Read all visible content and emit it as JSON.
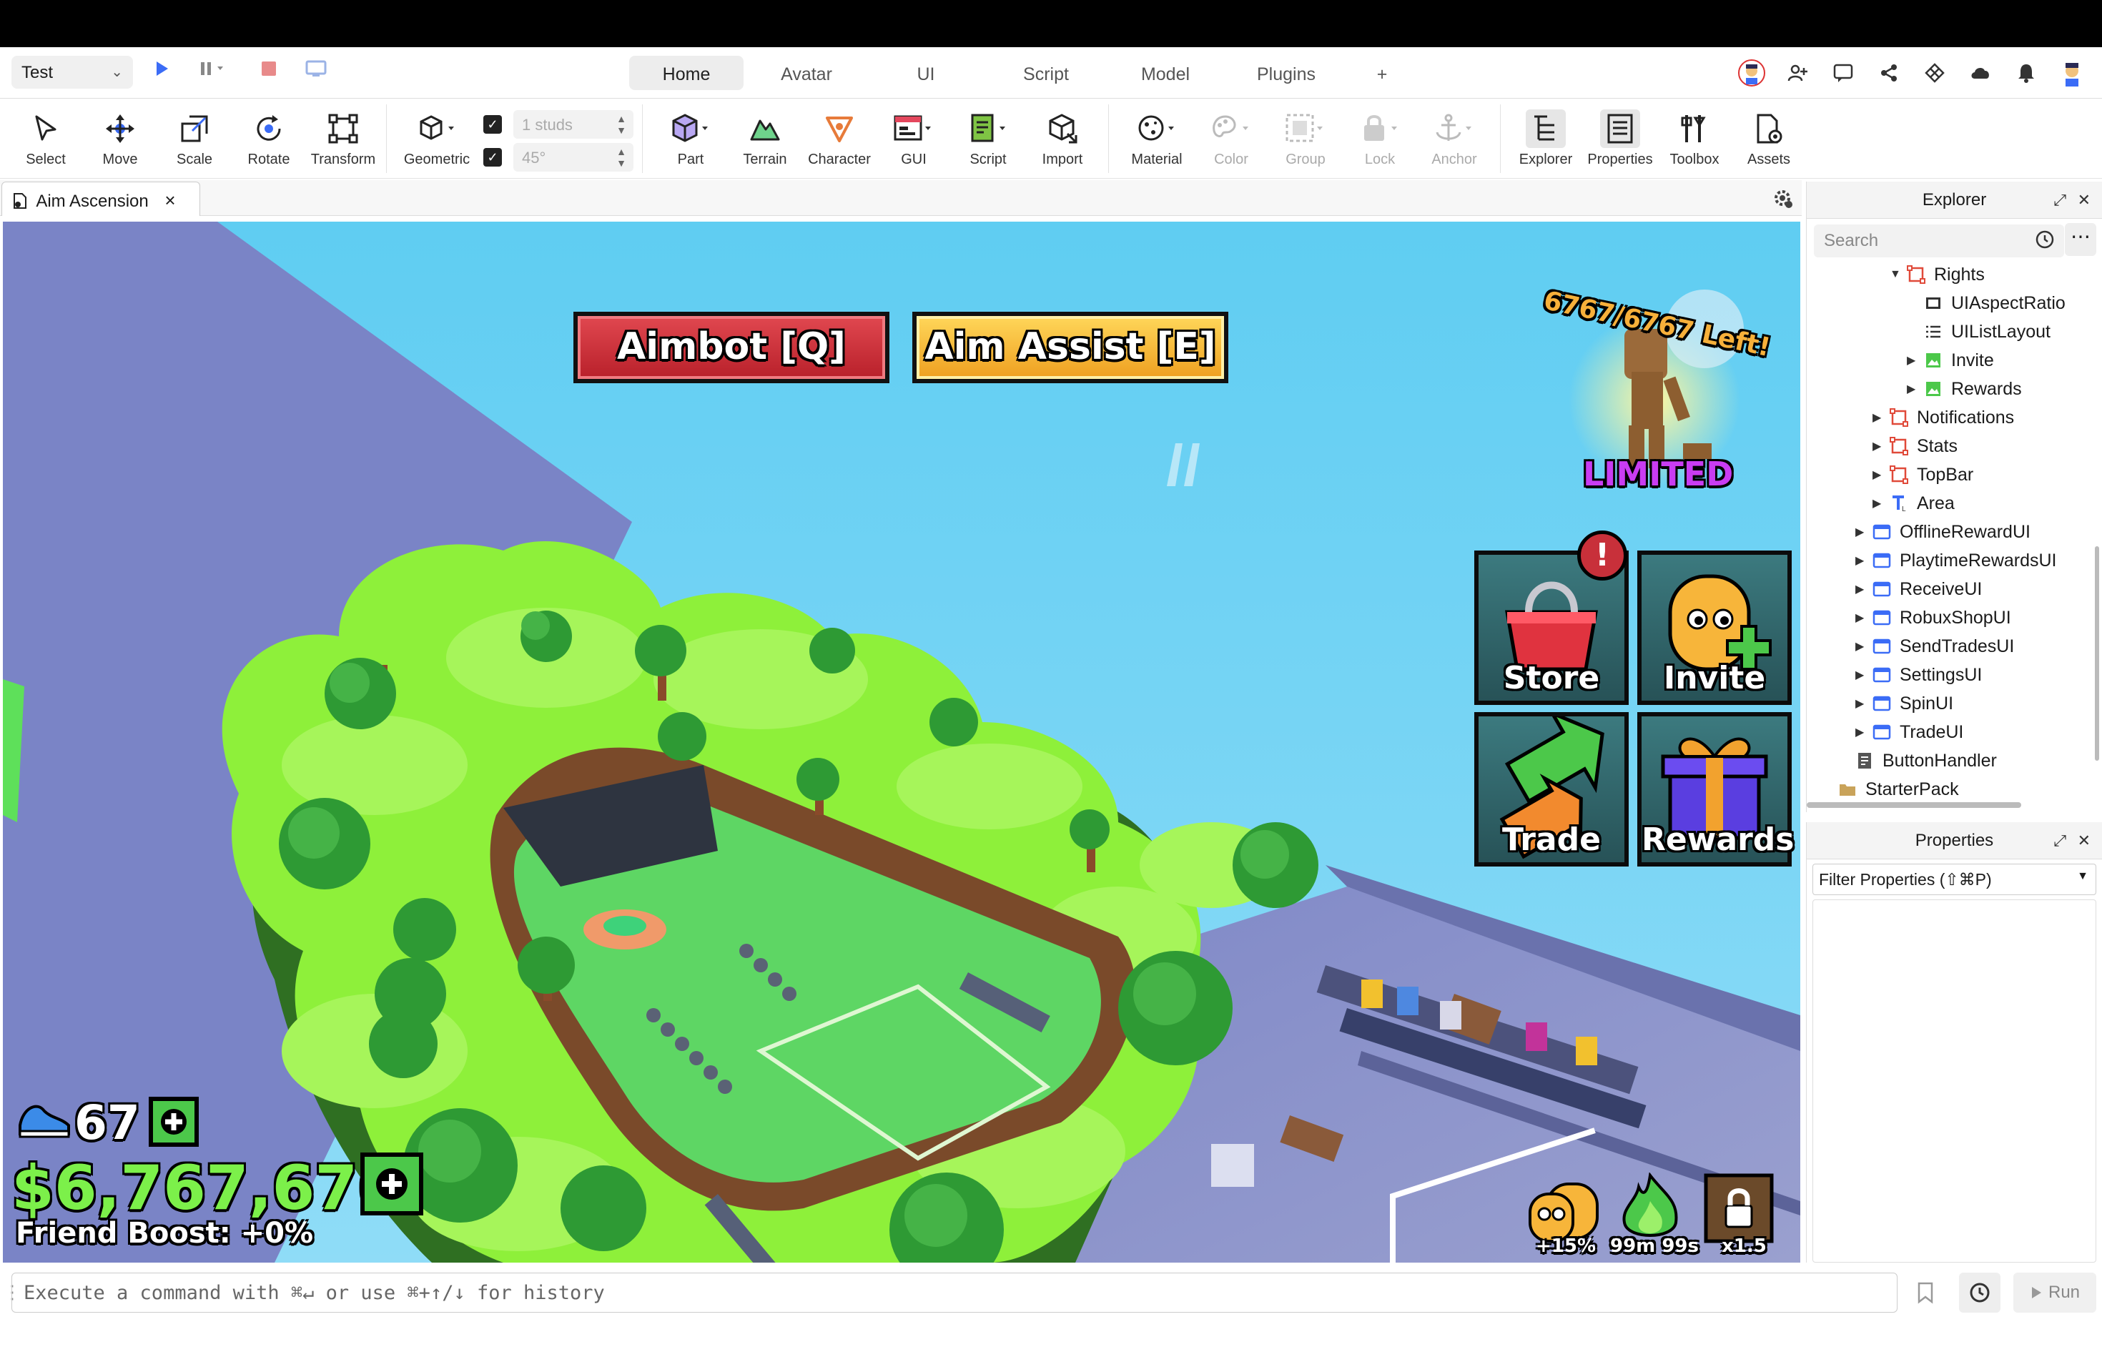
{
  "titlebar": {
    "mode": "Test",
    "tabs": [
      {
        "label": "Home",
        "active": true
      },
      {
        "label": "Avatar",
        "active": false
      },
      {
        "label": "UI",
        "active": false
      },
      {
        "label": "Script",
        "active": false
      },
      {
        "label": "Model",
        "active": false
      },
      {
        "label": "Plugins",
        "active": false
      },
      {
        "label": "+",
        "active": false
      }
    ]
  },
  "ribbon": {
    "tools": [
      "Select",
      "Move",
      "Scale",
      "Rotate",
      "Transform"
    ],
    "geometric": "Geometric",
    "snap_studs": "1 studs",
    "snap_angle": "45°",
    "insert": [
      "Part",
      "Terrain",
      "Character",
      "GUI",
      "Script",
      "Import"
    ],
    "edit": [
      "Material",
      "Color",
      "Group",
      "Lock",
      "Anchor"
    ],
    "panels": [
      "Explorer",
      "Properties",
      "Toolbox",
      "Assets"
    ]
  },
  "doc_tab": {
    "title": "Aim Ascension",
    "close": "×"
  },
  "game": {
    "aimbot": "Aimbot [Q]",
    "aim_assist": "Aim Assist [E]",
    "limited_count": "6767/6767 Left!",
    "limited": "LIMITED",
    "tiles": [
      "Store",
      "Invite",
      "Trade",
      "Rewards"
    ],
    "store_alert": "!",
    "speed": "67",
    "cash": "$6,767,676",
    "friend_boost": "Friend Boost: +0%",
    "boosts": [
      "+15%",
      "99m 99s",
      "x1.5"
    ]
  },
  "command": {
    "placeholder": "Execute a command with ⌘↵ or use ⌘+↑/↓ for history",
    "run": "Run"
  },
  "explorer": {
    "title": "Explorer",
    "search_placeholder": "Search",
    "items": [
      {
        "label": "Rights",
        "depth": 6,
        "arrow": "▼",
        "icon": "frame"
      },
      {
        "label": "UIAspectRatio",
        "depth": 7,
        "arrow": "",
        "icon": "constraint"
      },
      {
        "label": "UIListLayout",
        "depth": 7,
        "arrow": "",
        "icon": "list"
      },
      {
        "label": "Invite",
        "depth": 7,
        "arrow": "▶",
        "icon": "image"
      },
      {
        "label": "Rewards",
        "depth": 7,
        "arrow": "▶",
        "icon": "image"
      },
      {
        "label": "Notifications",
        "depth": 5,
        "arrow": "▶",
        "icon": "frame"
      },
      {
        "label": "Stats",
        "depth": 5,
        "arrow": "▶",
        "icon": "frame"
      },
      {
        "label": "TopBar",
        "depth": 5,
        "arrow": "▶",
        "icon": "frame"
      },
      {
        "label": "Area",
        "depth": 5,
        "arrow": "▶",
        "icon": "text"
      },
      {
        "label": "OfflineRewardUI",
        "depth": 4,
        "arrow": "▶",
        "icon": "screengui"
      },
      {
        "label": "PlaytimeRewardsUI",
        "depth": 4,
        "arrow": "▶",
        "icon": "screengui"
      },
      {
        "label": "ReceiveUI",
        "depth": 4,
        "arrow": "▶",
        "icon": "screengui"
      },
      {
        "label": "RobuxShopUI",
        "depth": 4,
        "arrow": "▶",
        "icon": "screengui"
      },
      {
        "label": "SendTradesUI",
        "depth": 4,
        "arrow": "▶",
        "icon": "screengui"
      },
      {
        "label": "SettingsUI",
        "depth": 4,
        "arrow": "▶",
        "icon": "screengui"
      },
      {
        "label": "SpinUI",
        "depth": 4,
        "arrow": "▶",
        "icon": "screengui"
      },
      {
        "label": "TradeUI",
        "depth": 4,
        "arrow": "▶",
        "icon": "screengui"
      },
      {
        "label": "ButtonHandler",
        "depth": 3,
        "arrow": "",
        "icon": "script"
      },
      {
        "label": "StarterPack",
        "depth": 2,
        "arrow": "",
        "icon": "folder"
      }
    ]
  },
  "properties": {
    "title": "Properties",
    "filter_placeholder": "Filter Properties (⇧⌘P)"
  },
  "colors": {
    "accent_blue": "#3b6cf6",
    "sky": "#6ed3f5",
    "grass": "#8ef03a",
    "cash_green": "#7cf04a",
    "aimbot_red": "#d8323a",
    "aim_assist_yellow": "#f6c23a",
    "limited_purple": "#c93cf2"
  }
}
